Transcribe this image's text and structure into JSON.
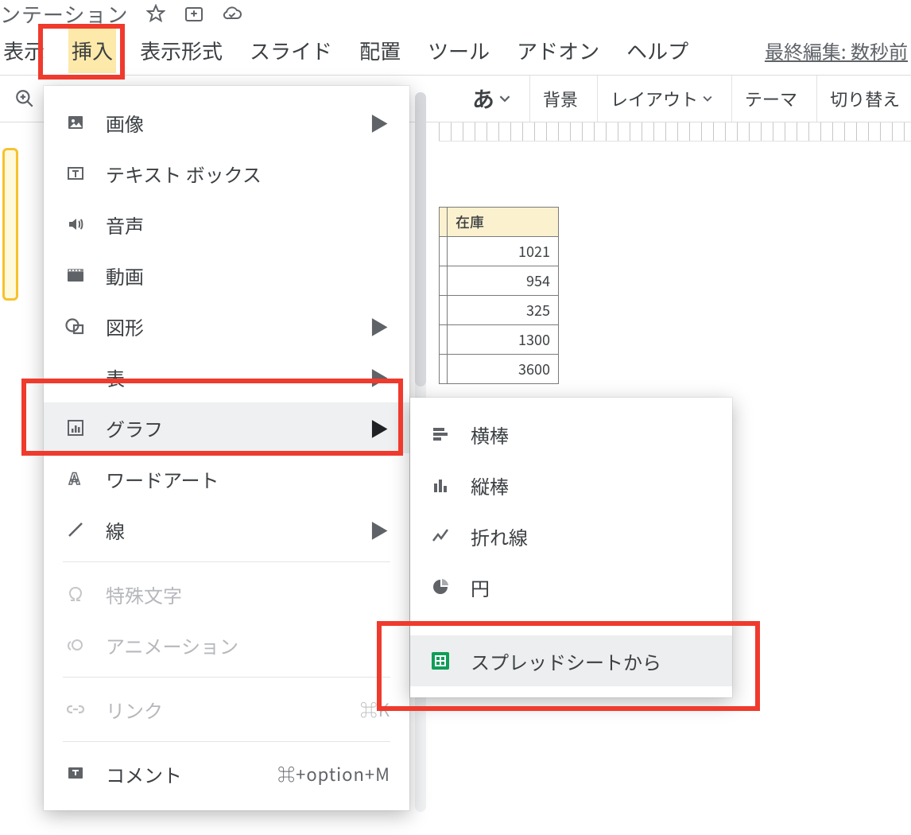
{
  "title_fragment": "ンテーション",
  "menubar": {
    "view": "表示",
    "insert": "挿入",
    "format": "表示形式",
    "slide": "スライド",
    "arrange": "配置",
    "tools": "ツール",
    "addons": "アドオン",
    "help": "ヘルプ"
  },
  "last_edit": "最終編集: 数秒前",
  "toolbar": {
    "ime": "あ",
    "background": "背景",
    "layout": "レイアウト",
    "theme": "テーマ",
    "transition": "切り替え"
  },
  "insert_menu": {
    "image": "画像",
    "textbox": "テキスト ボックス",
    "audio": "音声",
    "video": "動画",
    "shape": "図形",
    "table": "表",
    "chart": "グラフ",
    "wordart": "ワードアート",
    "line": "線",
    "special_chars": "特殊文字",
    "animation": "アニメーション",
    "link": "リンク",
    "link_shortcut": "⌘K",
    "comment": "コメント",
    "comment_shortcut": "⌘+option+M"
  },
  "chart_submenu": {
    "bar_h": "横棒",
    "bar_v": "縦棒",
    "line": "折れ線",
    "pie": "円",
    "from_sheets": "スプレッドシートから"
  },
  "bg_table": {
    "header": "在庫",
    "values": [
      "1021",
      "954",
      "325",
      "1300",
      "3600"
    ]
  }
}
